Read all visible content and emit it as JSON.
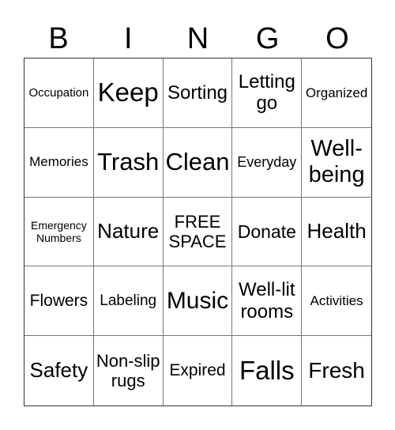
{
  "header": [
    "B",
    "I",
    "N",
    "G",
    "O"
  ],
  "cells": [
    {
      "text": "Occupation",
      "size": 15
    },
    {
      "text": "Keep",
      "size": 33
    },
    {
      "text": "Sorting",
      "size": 24
    },
    {
      "text": "Letting go",
      "size": 24
    },
    {
      "text": "Organized",
      "size": 17
    },
    {
      "text": "Memories",
      "size": 17
    },
    {
      "text": "Trash",
      "size": 31
    },
    {
      "text": "Clean",
      "size": 31
    },
    {
      "text": "Everyday",
      "size": 18
    },
    {
      "text": "Well-being",
      "size": 29
    },
    {
      "text": "Emergency Numbers",
      "size": 14
    },
    {
      "text": "Nature",
      "size": 26
    },
    {
      "text": "FREE SPACE",
      "size": 22
    },
    {
      "text": "Donate",
      "size": 23
    },
    {
      "text": "Health",
      "size": 26
    },
    {
      "text": "Flowers",
      "size": 21
    },
    {
      "text": "Labeling",
      "size": 19
    },
    {
      "text": "Music",
      "size": 30
    },
    {
      "text": "Well-lit rooms",
      "size": 24
    },
    {
      "text": "Activities",
      "size": 17
    },
    {
      "text": "Safety",
      "size": 26
    },
    {
      "text": "Non-slip rugs",
      "size": 22
    },
    {
      "text": "Expired",
      "size": 21
    },
    {
      "text": "Falls",
      "size": 33
    },
    {
      "text": "Fresh",
      "size": 28
    }
  ]
}
